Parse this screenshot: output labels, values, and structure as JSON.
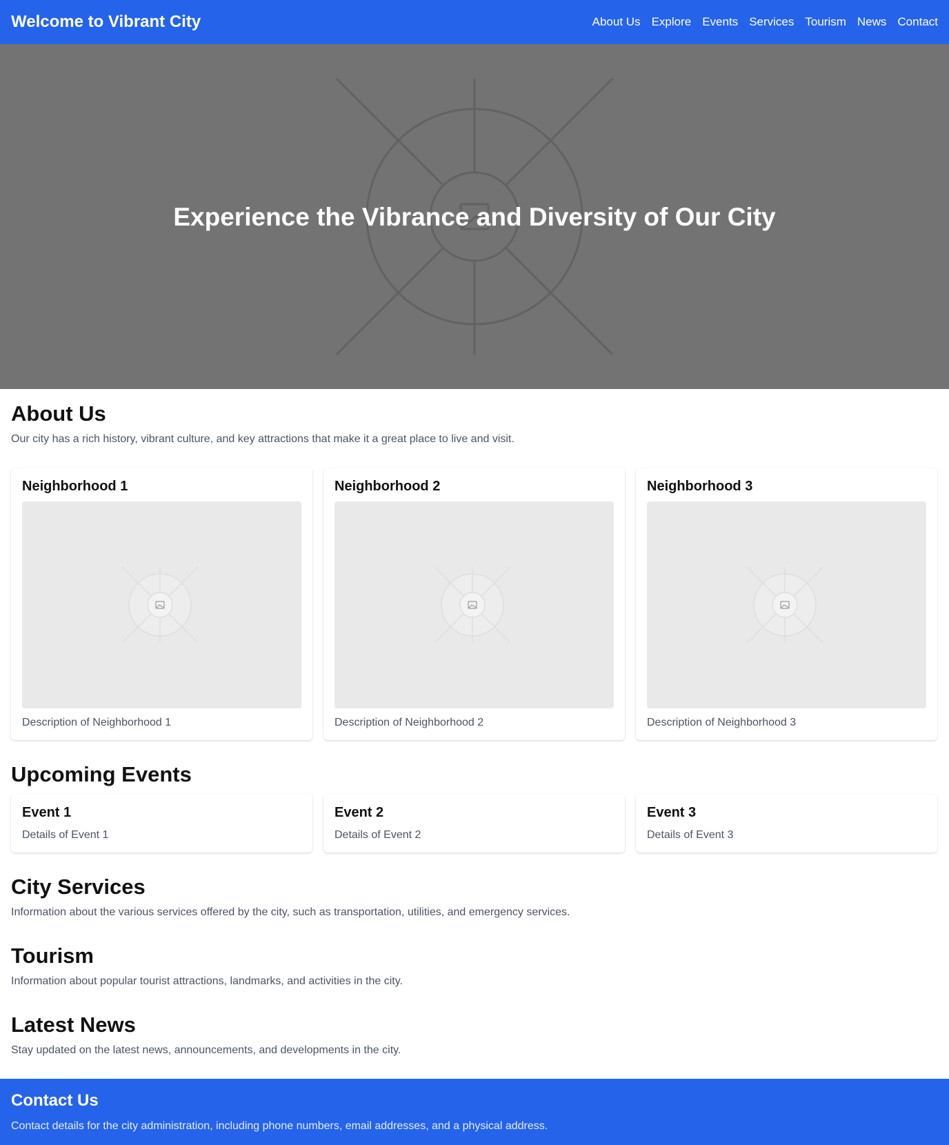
{
  "header": {
    "brand": "Welcome to Vibrant City",
    "nav": [
      "About Us",
      "Explore",
      "Events",
      "Services",
      "Tourism",
      "News",
      "Contact"
    ]
  },
  "hero": {
    "headline": "Experience the Vibrance and Diversity of Our City"
  },
  "about": {
    "title": "About Us",
    "text": "Our city has a rich history, vibrant culture, and key attractions that make it a great place to live and visit.",
    "neighborhoods": [
      {
        "name": "Neighborhood 1",
        "desc": "Description of Neighborhood 1"
      },
      {
        "name": "Neighborhood 2",
        "desc": "Description of Neighborhood 2"
      },
      {
        "name": "Neighborhood 3",
        "desc": "Description of Neighborhood 3"
      }
    ]
  },
  "events": {
    "title": "Upcoming Events",
    "items": [
      {
        "name": "Event 1",
        "details": "Details of Event 1"
      },
      {
        "name": "Event 2",
        "details": "Details of Event 2"
      },
      {
        "name": "Event 3",
        "details": "Details of Event 3"
      }
    ]
  },
  "services": {
    "title": "City Services",
    "text": "Information about the various services offered by the city, such as transportation, utilities, and emergency services."
  },
  "tourism": {
    "title": "Tourism",
    "text": "Information about popular tourist attractions, landmarks, and activities in the city."
  },
  "news": {
    "title": "Latest News",
    "text": "Stay updated on the latest news, announcements, and developments in the city."
  },
  "footer": {
    "title": "Contact Us",
    "text": "Contact details for the city administration, including phone numbers, email addresses, and a physical address."
  },
  "colors": {
    "primary": "#2563eb",
    "hero_bg": "#737373",
    "placeholder_bg": "#e9e9e9",
    "muted_text": "#4b5563"
  },
  "icons": {
    "placeholder": "image-placeholder-icon"
  }
}
